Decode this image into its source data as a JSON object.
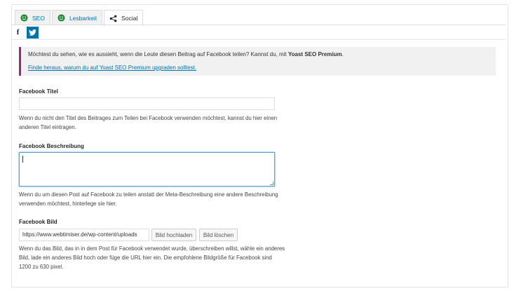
{
  "tabs": [
    {
      "label": "SEO",
      "icon": "smiley-icon",
      "color": "#1e8c34"
    },
    {
      "label": "Lesbarkeit",
      "icon": "smiley-icon",
      "color": "#1e8c34"
    },
    {
      "label": "Social",
      "icon": "share-icon"
    }
  ],
  "social_tabs": [
    {
      "icon": "facebook-icon",
      "glyph": "f"
    },
    {
      "icon": "twitter-icon"
    }
  ],
  "notice": {
    "text": "Möchtest du sehen, wie es aussieht, wenn die Leute diesen Beitrag auf Facebook teilen? Kannst du, mit ",
    "bold": "Yoast SEO Premium",
    "end": ".",
    "link": "Finde heraus, warum du auf Yoast SEO Premium upgraden solltest.",
    "accent": "#a4286a"
  },
  "facebook_title": {
    "label": "Facebook Titel",
    "value": "",
    "help": "Wenn du nicht den Titel des Beitrages zum Teilen bei Facebook verwenden möchtest, kannst du hier einen anderen Titel eintragen."
  },
  "facebook_description": {
    "label": "Facebook Beschreibung",
    "value": "",
    "help": "Wenn du um diesen Post auf Facebook zu teilen anstatt der Meta-Beschreibung eine andere Beschreibung verwenden möchtest, hinterlege sie hier."
  },
  "facebook_image": {
    "label": "Facebook Bild",
    "value": "https://www.webtimiser.de/wp-content/uploads",
    "upload_label": "Bild hochladen",
    "delete_label": "Bild löschen",
    "help": "Wenn du das Bild, das in in dem Post für Facebook verwendet wurde, überschreiben willst, wähle ein anderes Bild, lade ein anderes Bild hoch oder füge die URL hier ein. Die empfohlene Bildgröße für Facebook sind 1200 zu 630 pixel."
  }
}
